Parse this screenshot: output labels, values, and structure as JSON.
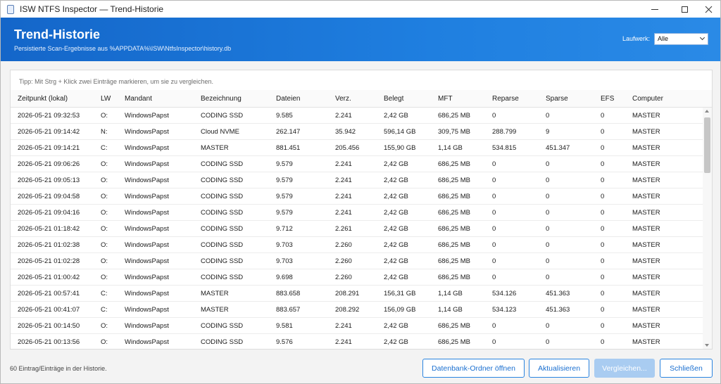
{
  "window": {
    "title": "ISW NTFS Inspector — Trend-Historie"
  },
  "header": {
    "title": "Trend-Historie",
    "subtitle": "Persistierte Scan-Ergebnisse aus %APPDATA%\\ISW\\NtfsInspector\\history.db",
    "drive_label": "Laufwerk:",
    "drive_value": "Alle"
  },
  "tip": "Tipp: Mit Strg + Klick zwei Einträge markieren, um sie zu vergleichen.",
  "table": {
    "columns": [
      "Zeitpunkt (lokal)",
      "LW",
      "Mandant",
      "Bezeichnung",
      "Dateien",
      "Verz.",
      "Belegt",
      "MFT",
      "Reparse",
      "Sparse",
      "EFS",
      "Computer"
    ],
    "rows": [
      [
        "2026-05-21 09:32:53",
        "O:",
        "WindowsPapst",
        "CODING SSD",
        "9.585",
        "2.241",
        "2,42 GB",
        "686,25 MB",
        "0",
        "0",
        "0",
        "MASTER"
      ],
      [
        "2026-05-21 09:14:42",
        "N:",
        "WindowsPapst",
        "Cloud NVME",
        "262.147",
        "35.942",
        "596,14 GB",
        "309,75 MB",
        "288.799",
        "9",
        "0",
        "MASTER"
      ],
      [
        "2026-05-21 09:14:21",
        "C:",
        "WindowsPapst",
        "MASTER",
        "881.451",
        "205.456",
        "155,90 GB",
        "1,14 GB",
        "534.815",
        "451.347",
        "0",
        "MASTER"
      ],
      [
        "2026-05-21 09:06:26",
        "O:",
        "WindowsPapst",
        "CODING SSD",
        "9.579",
        "2.241",
        "2,42 GB",
        "686,25 MB",
        "0",
        "0",
        "0",
        "MASTER"
      ],
      [
        "2026-05-21 09:05:13",
        "O:",
        "WindowsPapst",
        "CODING SSD",
        "9.579",
        "2.241",
        "2,42 GB",
        "686,25 MB",
        "0",
        "0",
        "0",
        "MASTER"
      ],
      [
        "2026-05-21 09:04:58",
        "O:",
        "WindowsPapst",
        "CODING SSD",
        "9.579",
        "2.241",
        "2,42 GB",
        "686,25 MB",
        "0",
        "0",
        "0",
        "MASTER"
      ],
      [
        "2026-05-21 09:04:16",
        "O:",
        "WindowsPapst",
        "CODING SSD",
        "9.579",
        "2.241",
        "2,42 GB",
        "686,25 MB",
        "0",
        "0",
        "0",
        "MASTER"
      ],
      [
        "2026-05-21 01:18:42",
        "O:",
        "WindowsPapst",
        "CODING SSD",
        "9.712",
        "2.261",
        "2,42 GB",
        "686,25 MB",
        "0",
        "0",
        "0",
        "MASTER"
      ],
      [
        "2026-05-21 01:02:38",
        "O:",
        "WindowsPapst",
        "CODING SSD",
        "9.703",
        "2.260",
        "2,42 GB",
        "686,25 MB",
        "0",
        "0",
        "0",
        "MASTER"
      ],
      [
        "2026-05-21 01:02:28",
        "O:",
        "WindowsPapst",
        "CODING SSD",
        "9.703",
        "2.260",
        "2,42 GB",
        "686,25 MB",
        "0",
        "0",
        "0",
        "MASTER"
      ],
      [
        "2026-05-21 01:00:42",
        "O:",
        "WindowsPapst",
        "CODING SSD",
        "9.698",
        "2.260",
        "2,42 GB",
        "686,25 MB",
        "0",
        "0",
        "0",
        "MASTER"
      ],
      [
        "2026-05-21 00:57:41",
        "C:",
        "WindowsPapst",
        "MASTER",
        "883.658",
        "208.291",
        "156,31 GB",
        "1,14 GB",
        "534.126",
        "451.363",
        "0",
        "MASTER"
      ],
      [
        "2026-05-21 00:41:07",
        "C:",
        "WindowsPapst",
        "MASTER",
        "883.657",
        "208.292",
        "156,09 GB",
        "1,14 GB",
        "534.123",
        "451.363",
        "0",
        "MASTER"
      ],
      [
        "2026-05-21 00:14:50",
        "O:",
        "WindowsPapst",
        "CODING SSD",
        "9.581",
        "2.241",
        "2,42 GB",
        "686,25 MB",
        "0",
        "0",
        "0",
        "MASTER"
      ],
      [
        "2026-05-21 00:13:56",
        "O:",
        "WindowsPapst",
        "CODING SSD",
        "9.576",
        "2.241",
        "2,42 GB",
        "686,25 MB",
        "0",
        "0",
        "0",
        "MASTER"
      ]
    ]
  },
  "footer": {
    "status": "60 Eintrag/Einträge in der Historie.",
    "btn_open_folder": "Datenbank-Ordner öffnen",
    "btn_refresh": "Aktualisieren",
    "btn_compare": "Vergleichen...",
    "btn_close": "Schließen"
  },
  "colors": {
    "header_start": "#1466c9",
    "header_end": "#2a8ae6",
    "accent": "#2a84e0",
    "disabled": "#a9ccf1"
  },
  "icons": {
    "app": "app-icon",
    "minimize": "minimize-icon",
    "maximize": "maximize-icon",
    "close": "close-icon",
    "dropdown": "chevron-down-icon"
  }
}
